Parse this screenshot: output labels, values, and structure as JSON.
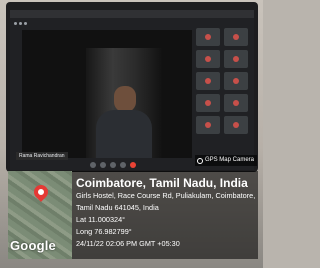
{
  "screen": {
    "participant_name": "Rama Ravichandran"
  },
  "gps_badge": {
    "label": "GPS Map Camera",
    "icon": "gps-camera-icon"
  },
  "location": {
    "city": "Coimbatore, Tamil Nadu, India",
    "address_line1": "Girls Hostel, Race Course Rd, Puliakulam, Coimbatore,",
    "address_line2": "Tamil Nadu 641045, India",
    "lat": "Lat 11.000324°",
    "long": "Long 76.982799°",
    "timestamp": "24/11/22 02:06 PM GMT +05:30"
  },
  "map": {
    "brand": "Google",
    "pin_icon": "map-pin-icon",
    "pin_color": "#e53935"
  }
}
